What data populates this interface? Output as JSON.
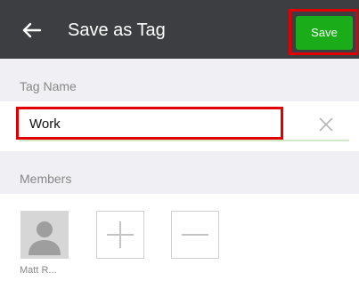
{
  "header": {
    "title": "Save as Tag",
    "save_label": "Save",
    "back_icon": "back-arrow-icon"
  },
  "tag": {
    "section_label": "Tag Name",
    "value": "Work",
    "clear_icon": "close-icon"
  },
  "members": {
    "section_label": "Members",
    "list": [
      {
        "name": "Matt R..."
      }
    ],
    "add_icon": "plus-icon",
    "remove_icon": "minus-icon"
  },
  "colors": {
    "topbar": "#3d3e42",
    "save_green": "#1aad19",
    "highlight_red": "#e00000"
  }
}
